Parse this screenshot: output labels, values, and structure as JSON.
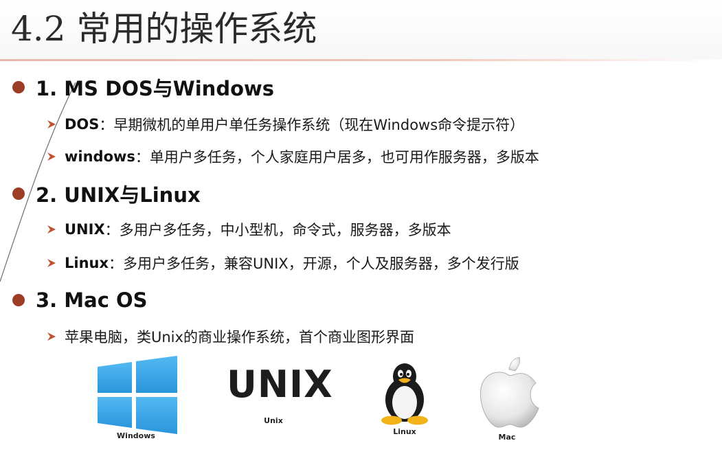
{
  "slide": {
    "title": "4.2 常用的操作系统",
    "sections": [
      {
        "heading": "1. MS DOS与Windows",
        "items": [
          {
            "keyword": "DOS",
            "text": "：早期微机的单用户单任务操作系统（现在Windows命令提示符）"
          },
          {
            "keyword": "windows",
            "text": "：单用户多任务，个人家庭用户居多，也可用作服务器，多版本"
          }
        ]
      },
      {
        "heading": "2. UNIX与Linux",
        "items": [
          {
            "keyword": "UNIX",
            "text": "：多用户多任务，中小型机，命令式，服务器，多版本"
          },
          {
            "keyword": "Linux",
            "text": "：多用户多任务，兼容UNIX，开源，个人及服务器，多个发行版"
          }
        ]
      },
      {
        "heading": "3. Mac OS",
        "items": [
          {
            "keyword": "",
            "text": "苹果电脑，类Unix的商业操作系统，首个商业图形界面"
          }
        ]
      }
    ],
    "logos": {
      "windows": {
        "caption": "Windows",
        "icon": "windows-logo-icon"
      },
      "unix": {
        "wordmark": "UNIX",
        "caption": "Unix",
        "icon": "unix-wordmark"
      },
      "linux": {
        "caption": "Linux",
        "icon": "tux-penguin-icon"
      },
      "mac": {
        "caption": "Mac",
        "icon": "apple-logo-icon"
      }
    },
    "colors": {
      "bullet": "#9e3d26",
      "arrow": "#c0522f",
      "windows_blue": "#3aa7ea",
      "title_rule": "#e7b6a7"
    }
  }
}
